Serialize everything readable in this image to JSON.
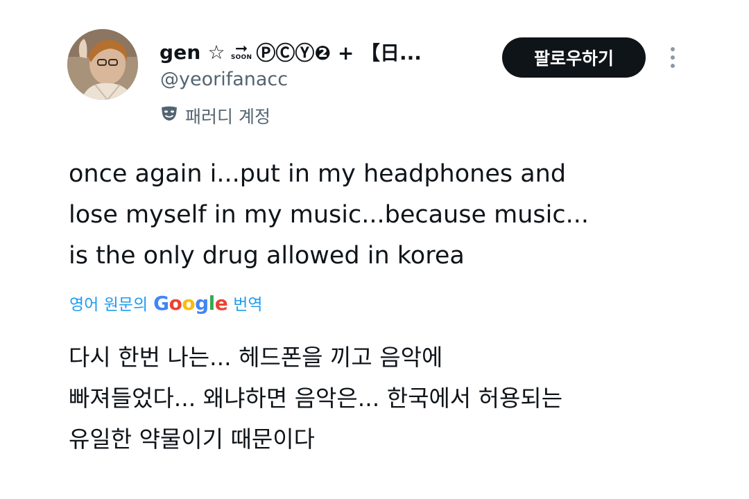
{
  "tweet": {
    "display_name": "gen ☆",
    "soon_label": "SOON",
    "name_suffix": "ⓅⒸⓎ❷ + 【日...",
    "handle": "@yeorifanacc",
    "parody_label": "패러디 계정",
    "follow_label": "팔로우하기",
    "text_lines": [
      "once again i...put in my headphones and",
      "lose myself in my music...because music...",
      "is the only drug allowed in korea"
    ],
    "translate": {
      "prefix": "영어 원문의",
      "brand": "Google",
      "suffix": "번역"
    },
    "translated_lines": [
      "다시 한번 나는... 헤드폰을 끼고 음악에",
      "빠져들었다... 왜냐하면 음악은... 한국에서 허용되는",
      "유일한 약물이기 때문이다"
    ]
  },
  "icons": {
    "parody": "theater-mask-icon",
    "more": "more-vertical-icon",
    "arrow": "right-arrow-icon"
  },
  "colors": {
    "text": "#0f1419",
    "secondary": "#536471",
    "link": "#1d9bf0",
    "button": "#0f1419",
    "google_blue": "#4285f4",
    "google_red": "#ea4335",
    "google_yellow": "#fbbc05",
    "google_green": "#34a853"
  }
}
